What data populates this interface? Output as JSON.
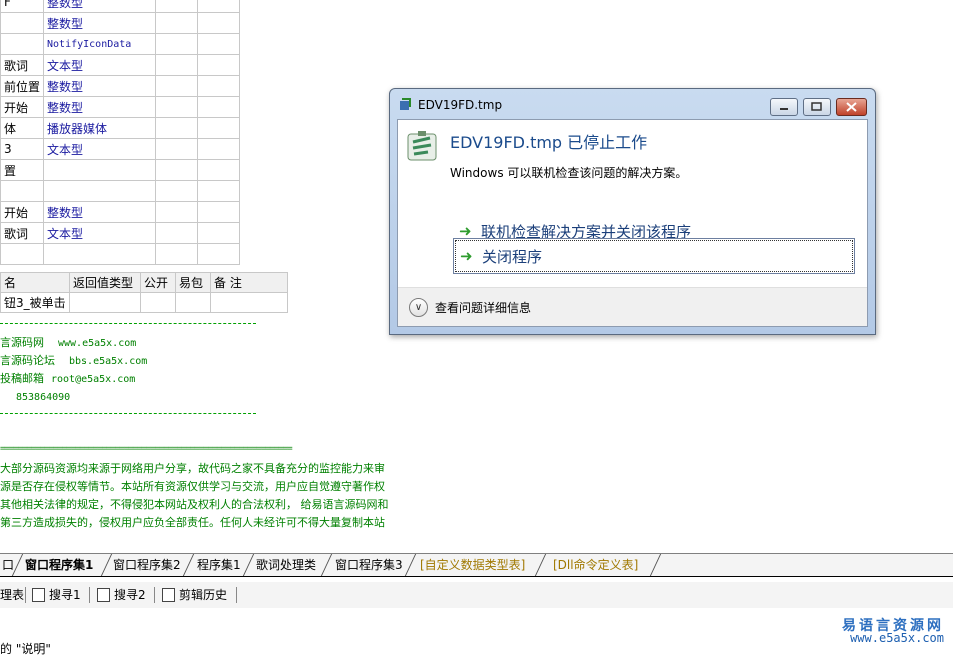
{
  "vars_table": [
    {
      "name": "F",
      "type": "整数型"
    },
    {
      "name": "",
      "type": "整数型"
    },
    {
      "name": "",
      "type": "NotifyIconData"
    },
    {
      "name": "歌词",
      "type": "文本型"
    },
    {
      "name": "前位置",
      "type": "整数型"
    },
    {
      "name": "开始",
      "type": "整数型"
    },
    {
      "name": "体",
      "type": "播放器媒体"
    },
    {
      "name": "3",
      "type": "文本型"
    },
    {
      "name": "置",
      "type": ""
    },
    {
      "name": "",
      "type": ""
    },
    {
      "name": "开始",
      "type": "整数型"
    },
    {
      "name": "歌词",
      "type": "文本型"
    },
    {
      "name": "",
      "type": ""
    }
  ],
  "sub_table": {
    "headers": [
      "名",
      "返回值类型",
      "公开",
      "易包",
      "备 注"
    ],
    "row": [
      "钮3_被单击",
      "",
      "",
      "",
      ""
    ]
  },
  "comments": {
    "lines": [
      {
        "cn": "言源码网",
        "en": "www.e5a5x.com"
      },
      {
        "cn": "言源码论坛",
        "en": "bbs.e5a5x.com"
      },
      {
        "cn": "投稿邮箱",
        "en": "root@e5a5x.com"
      },
      {
        "cn": "",
        "en": "853864090"
      }
    ],
    "eq_line": "==================================================================",
    "disclaimer": [
      "大部分源码资源均来源于网络用户分享，故代码之家不具备充分的监控能力来审",
      "源是否存在侵权等情节。本站所有资源仅供学习与交流，用户应自觉遵守著作权",
      "其他相关法律的规定，不得侵犯本网站及权利人的合法权利， 给易语言源码网和",
      "第三方造成损失的，侵权用户应负全部责任。任何人未经许可不得大量复制本站"
    ]
  },
  "tabs": [
    {
      "label": "口",
      "active": false,
      "custom": false
    },
    {
      "label": "窗口程序集1",
      "active": true,
      "custom": false
    },
    {
      "label": "窗口程序集2",
      "active": false,
      "custom": false
    },
    {
      "label": "程序集1",
      "active": false,
      "custom": false
    },
    {
      "label": "歌词处理类",
      "active": false,
      "custom": false
    },
    {
      "label": "窗口程序集3",
      "active": false,
      "custom": false
    },
    {
      "label": "[自定义数据类型表]",
      "active": false,
      "custom": true
    },
    {
      "label": "[Dll命令定义表]",
      "active": false,
      "custom": true
    }
  ],
  "toolbar": [
    "理表",
    "搜寻1",
    "搜寻2",
    "剪辑历史"
  ],
  "cut_text": "的 \"说明\"",
  "watermark": {
    "cn": "易语言资源网",
    "url": "www.e5a5x.com"
  },
  "dialog": {
    "title": "EDV19FD.tmp",
    "heading": "EDV19FD.tmp 已停止工作",
    "subtext": "Windows 可以联机检查该问题的解决方案。",
    "option1": "联机检查解决方案并关闭该程序",
    "option2": "关闭程序",
    "details": "查看问题详细信息"
  }
}
